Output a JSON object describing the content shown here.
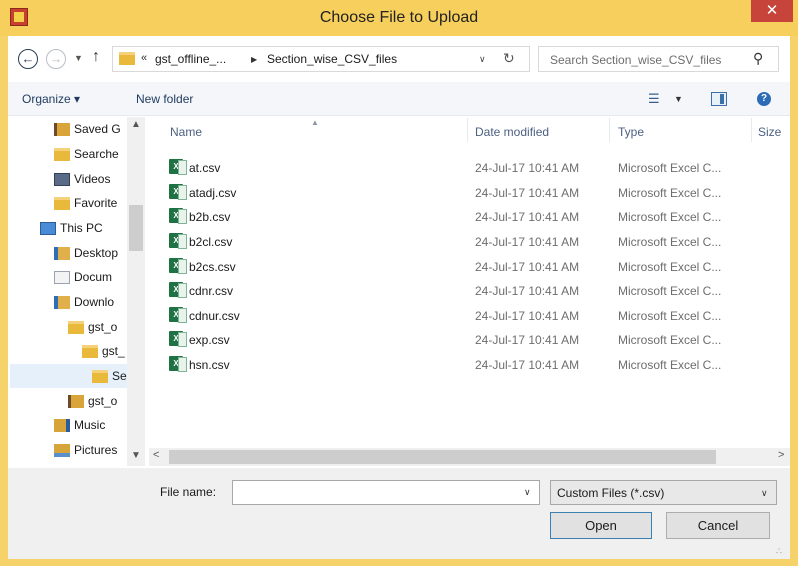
{
  "window": {
    "title": "Choose File to Upload",
    "close_glyph": "✕"
  },
  "nav": {
    "back_glyph": "←",
    "forward_glyph": "→",
    "recent_glyph": "▼",
    "up_glyph": "↑",
    "breadcrumb_overflow": "«",
    "breadcrumb": [
      "gst_offline_...",
      "Section_wise_CSV_files"
    ],
    "crumb_sep": "▶",
    "address_drop_glyph": "∨",
    "refresh_glyph": "↻",
    "search_placeholder": "Search Section_wise_CSV_files",
    "search_glyph": "⚲"
  },
  "toolbar": {
    "organize_label": "Organize ▾",
    "new_folder_label": "New folder",
    "views_glyph": "☰",
    "views_drop_glyph": "▼",
    "help_glyph": "?"
  },
  "tree": [
    {
      "label": "Saved G",
      "icon": "saved-games-icon"
    },
    {
      "label": "Searche",
      "icon": "searches-icon"
    },
    {
      "label": "Videos",
      "icon": "videos-icon"
    },
    {
      "label": "Favorite",
      "icon": "favorites-icon"
    },
    {
      "label": "This PC",
      "icon": "this-pc-icon"
    },
    {
      "label": "Desktop",
      "icon": "desktop-icon"
    },
    {
      "label": "Docum",
      "icon": "documents-icon"
    },
    {
      "label": "Downlo",
      "icon": "downloads-icon"
    },
    {
      "label": "gst_o",
      "icon": "folder-icon"
    },
    {
      "label": "gst_",
      "icon": "folder-icon"
    },
    {
      "label": "Se",
      "icon": "folder-icon"
    },
    {
      "label": "gst_o",
      "icon": "folder-icon"
    },
    {
      "label": "Music",
      "icon": "music-icon"
    },
    {
      "label": "Pictures",
      "icon": "pictures-icon"
    }
  ],
  "tree_scroll": {
    "up_glyph": "▲",
    "down_glyph": "▼"
  },
  "columns": {
    "name": "Name",
    "date": "Date modified",
    "type": "Type",
    "size": "Size",
    "sort_glyph": "▲"
  },
  "files": [
    {
      "name": "at.csv",
      "date": "24-Jul-17 10:41 AM",
      "type": "Microsoft Excel C..."
    },
    {
      "name": "atadj.csv",
      "date": "24-Jul-17 10:41 AM",
      "type": "Microsoft Excel C..."
    },
    {
      "name": "b2b.csv",
      "date": "24-Jul-17 10:41 AM",
      "type": "Microsoft Excel C..."
    },
    {
      "name": "b2cl.csv",
      "date": "24-Jul-17 10:41 AM",
      "type": "Microsoft Excel C..."
    },
    {
      "name": "b2cs.csv",
      "date": "24-Jul-17 10:41 AM",
      "type": "Microsoft Excel C..."
    },
    {
      "name": "cdnr.csv",
      "date": "24-Jul-17 10:41 AM",
      "type": "Microsoft Excel C..."
    },
    {
      "name": "cdnur.csv",
      "date": "24-Jul-17 10:41 AM",
      "type": "Microsoft Excel C..."
    },
    {
      "name": "exp.csv",
      "date": "24-Jul-17 10:41 AM",
      "type": "Microsoft Excel C..."
    },
    {
      "name": "hsn.csv",
      "date": "24-Jul-17 10:41 AM",
      "type": "Microsoft Excel C..."
    }
  ],
  "hscroll": {
    "left_glyph": "<",
    "right_glyph": ">"
  },
  "bottom": {
    "file_name_label": "File name:",
    "file_name_value": "",
    "file_name_drop_glyph": "∨",
    "filter_value": "Custom Files (*.csv)",
    "filter_drop_glyph": "∨",
    "open_label": "Open",
    "cancel_label": "Cancel"
  },
  "colors": {
    "title_bar": "#f6cf5c",
    "close_button": "#c7443a",
    "excel_green": "#1f7244",
    "selected_row": "#e5f0fb"
  }
}
